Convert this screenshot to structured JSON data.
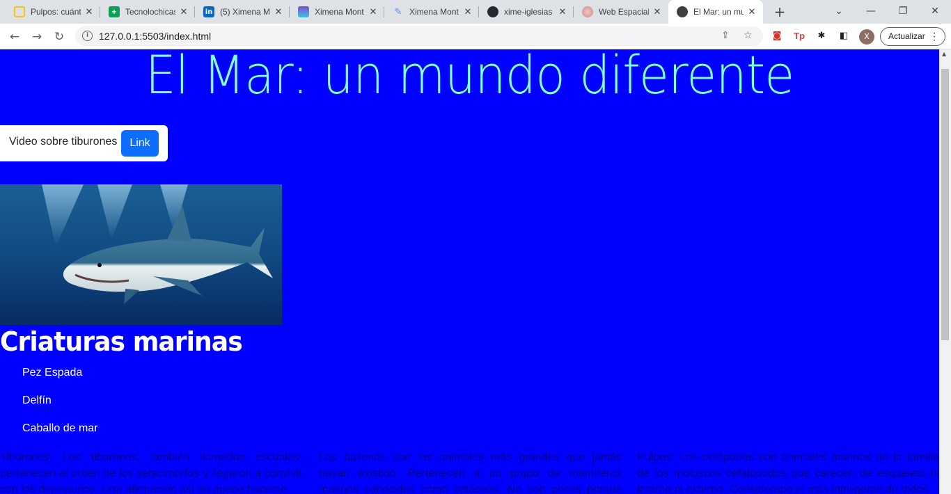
{
  "browser": {
    "tabs": [
      {
        "title": "Pulpos: cuánt",
        "favicon": "natgeo-icon",
        "color": "#f5c518"
      },
      {
        "title": "Tecnolochicas",
        "favicon": "sheets-icon",
        "color": "#0f9d58"
      },
      {
        "title": "(5) Ximena M",
        "favicon": "linkedin-icon",
        "color": "#0a66c2"
      },
      {
        "title": "Ximena Mont",
        "favicon": "canva-icon",
        "color": "#7b4fd0"
      },
      {
        "title": "Ximena Mont",
        "favicon": "pen-icon",
        "color": "#5b8def"
      },
      {
        "title": "xime-iglesias",
        "favicon": "github-icon",
        "color": "#24292f"
      },
      {
        "title": "Web Espacial",
        "favicon": "galaxy-icon",
        "color": "#e8a0a0"
      },
      {
        "title": "El Mar: un mu",
        "favicon": "globe-icon",
        "color": "#3c4043",
        "active": true
      }
    ],
    "url": "127.0.0.1:5503/index.html",
    "update_label": "Actualizar",
    "avatar_letter": "X"
  },
  "page": {
    "heading": "El Mar: un mundo diferente",
    "video_label": "Video sobre tiburones",
    "link_button": "Link",
    "section_title": "Criaturas marinas",
    "creatures": [
      "Pez Espada",
      "Delfín",
      "Caballo de mar"
    ],
    "columns": [
      "Tiburones: Los tiburones, también llamados escualos, pertenecen al orden de los selacimorfos y llegaron a convivir con los dinosaurios. Una afirmación así no puede hacerse",
      "Las ballenas son los animales más grandes que jamás hayan existido. Pertenecen a un grupo de mamíferos marinos conocidos como cetáceos. No son peces porque tienen",
      "Pulpos: Los octópodos son animales marinos de la familia de los moluscos cefalópodos que carecen de esqueleto ni interno ni externo. Considerado el más inteligente de todos"
    ],
    "colors": {
      "background": "#0000ff",
      "heading": "#7fffd4",
      "button": "#0d6efd",
      "text": "#00008b"
    }
  }
}
